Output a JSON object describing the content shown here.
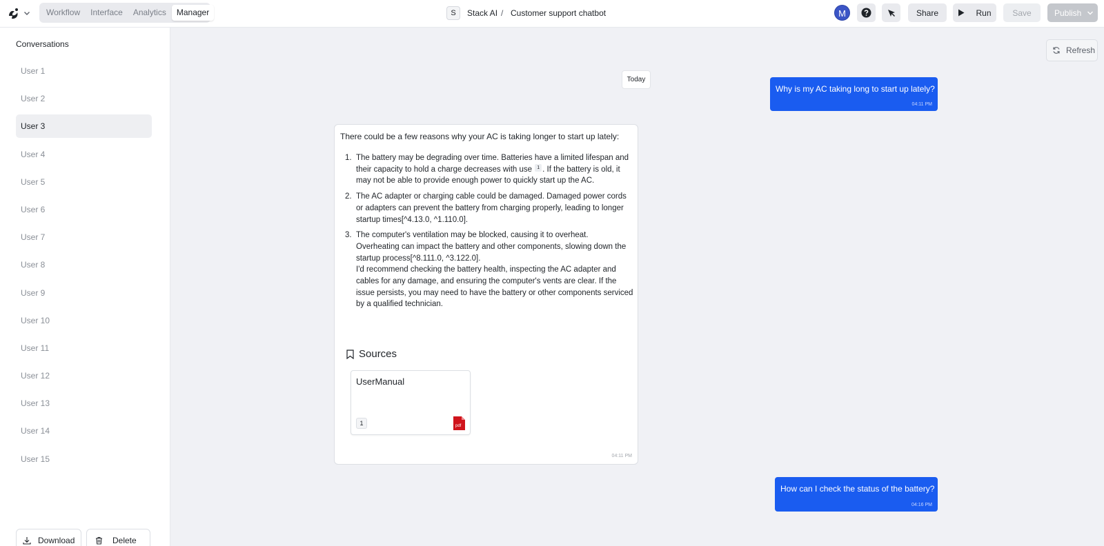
{
  "topbar": {
    "tabs": [
      {
        "label": "Workflow"
      },
      {
        "label": "Interface"
      },
      {
        "label": "Analytics"
      },
      {
        "label": "Manager",
        "active": true
      }
    ],
    "org_initial": "S",
    "org_name": "Stack AI",
    "separator": "/",
    "project_name": "Customer support chatbot",
    "avatar_initial": "M",
    "share_label": "Share",
    "run_label": "Run",
    "save_label": "Save",
    "publish_label": "Publish"
  },
  "sidebar": {
    "title": "Conversations",
    "users": [
      "User 1",
      "User 2",
      "User 3",
      "User 4",
      "User 5",
      "User 6",
      "User 7",
      "User 8",
      "User 9",
      "User 10",
      "User 11",
      "User 12",
      "User 13",
      "User 14",
      "User 15"
    ],
    "selected_user": "User 3",
    "download_label": "Download",
    "delete_label": "Delete"
  },
  "main": {
    "refresh_label": "Refresh",
    "date_chip": "Today",
    "user_message_1": {
      "text": "Why is my AC taking long to start up lately?",
      "time": "04:11 PM"
    },
    "bot_message": {
      "intro": "There could be a few reasons why your AC is taking longer to start up lately:",
      "items": [
        {
          "num": "1.",
          "text_a": "The battery may be degrading over time. Batteries have a limited lifespan and their capacity to hold a charge decreases with use",
          "cite": "1",
          "text_b": ". If the battery is old, it may not be able to provide enough power to quickly start up the AC."
        },
        {
          "num": "2.",
          "text": "The AC adapter or charging cable could be damaged. Damaged power cords or adapters can prevent the battery from charging properly, leading to longer startup times[^4.13.0, ^1.110.0]."
        },
        {
          "num": "3.",
          "text": "The computer's ventilation may be blocked, causing it to overheat. Overheating can impact the battery and other components, slowing down the startup process[^8.111.0, ^3.122.0].",
          "closing": "I'd recommend checking the battery health, inspecting the AC adapter and cables for any damage, and ensuring the computer's vents are clear. If the issue persists, you may need to have the battery or other components serviced by a qualified technician."
        }
      ],
      "sources_title": "Sources",
      "source": {
        "name": "UserManual",
        "page": "1",
        "file_type": "pdf"
      },
      "time": "04:11 PM"
    },
    "user_message_2": {
      "text": "How can I check the status of the battery?",
      "time": "04:16 PM"
    }
  },
  "colors": {
    "accent": "#1a5cf0",
    "avatar": "#3b55c6",
    "pdf": "#d0141c"
  },
  "icons": [
    "logo-icon",
    "chevron-down-icon",
    "help-icon",
    "cursor-icon",
    "play-icon",
    "refresh-icon",
    "download-icon",
    "trash-icon",
    "bookmark-icon",
    "pdf-icon"
  ]
}
